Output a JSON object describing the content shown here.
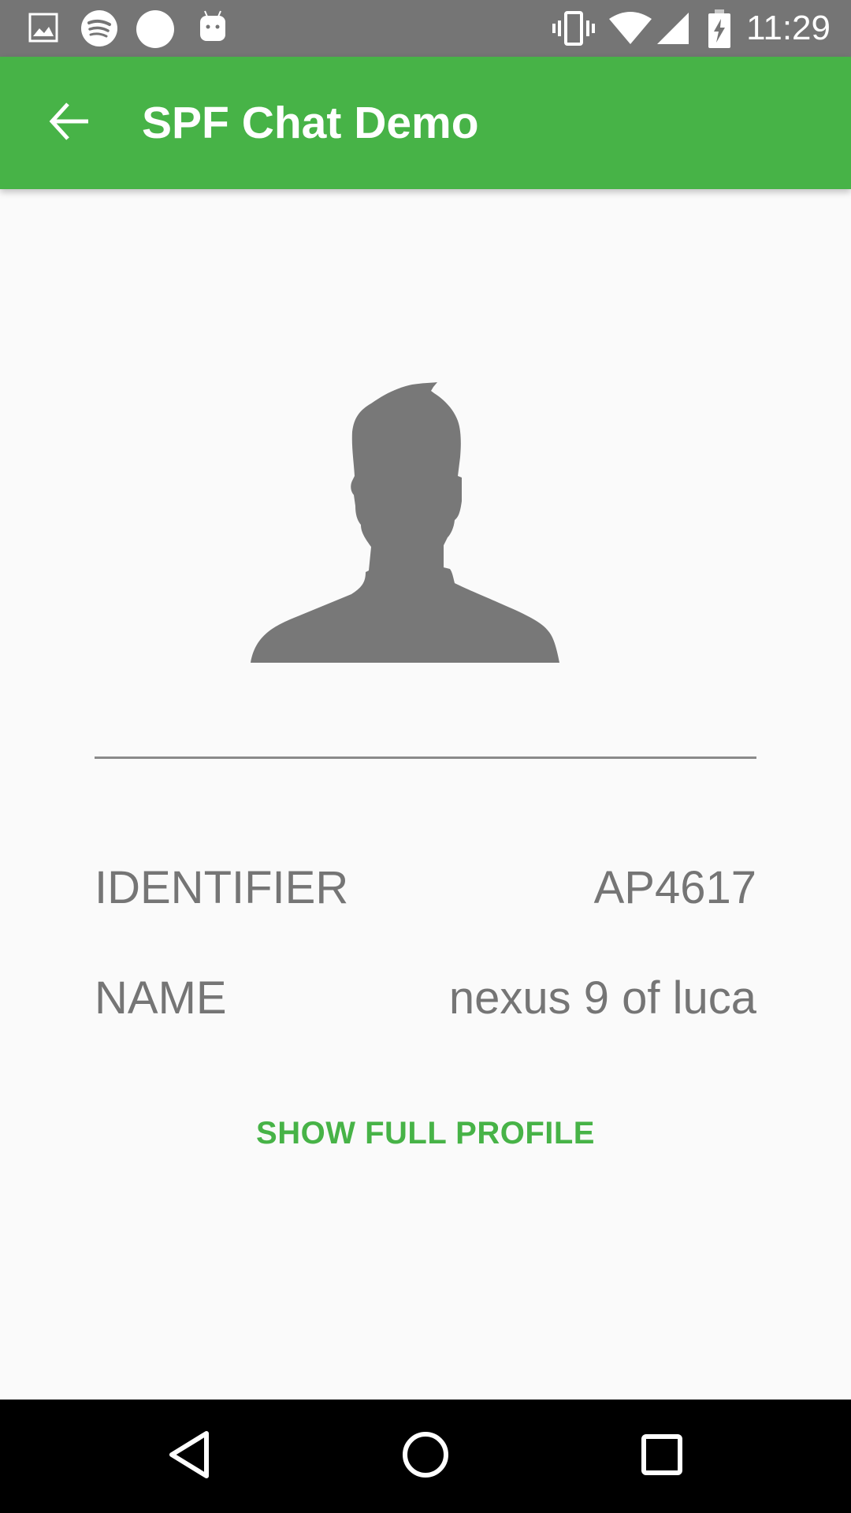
{
  "status_bar": {
    "time": "11:29",
    "left_icons": [
      "image-icon",
      "spotify-icon",
      "circle-icon",
      "android-icon"
    ],
    "right_icons": [
      "vibrate-icon",
      "wifi-icon",
      "signal-icon",
      "battery-charging-icon"
    ]
  },
  "app_bar": {
    "title": "SPF Chat Demo",
    "back_icon": "arrow-back-icon",
    "color": "#47b347"
  },
  "profile": {
    "avatar_icon": "person-silhouette-icon",
    "fields": [
      {
        "label": "IDENTIFIER",
        "value": "AP4617"
      },
      {
        "label": "NAME",
        "value": "nexus 9 of luca"
      }
    ],
    "action_label": "SHOW FULL PROFILE"
  },
  "nav_bar": {
    "buttons": [
      "back-triangle-icon",
      "home-circle-icon",
      "recents-square-icon"
    ]
  }
}
